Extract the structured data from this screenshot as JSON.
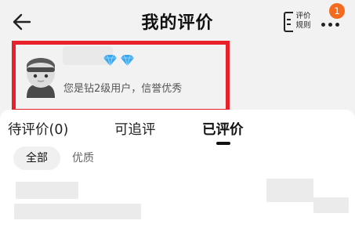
{
  "header": {
    "title": "我的评价",
    "rules_label": "评价\n规则",
    "notification_count": "1"
  },
  "profile": {
    "level_text": "您是钻2级用户，信誉优秀",
    "level_icon": "blue-diamond",
    "diamond_count": 2,
    "diamond_color": "#3aa8f0"
  },
  "tabs": [
    {
      "label": "待评价(0)",
      "active": false
    },
    {
      "label": "可追评",
      "active": false
    },
    {
      "label": "已评价",
      "active": true
    }
  ],
  "filters": [
    {
      "label": "全部",
      "selected": true
    },
    {
      "label": "优质",
      "selected": false
    }
  ],
  "colors": {
    "highlight_border": "#e8202a",
    "badge": "#f56a1f",
    "background": "#f2f2f2"
  }
}
